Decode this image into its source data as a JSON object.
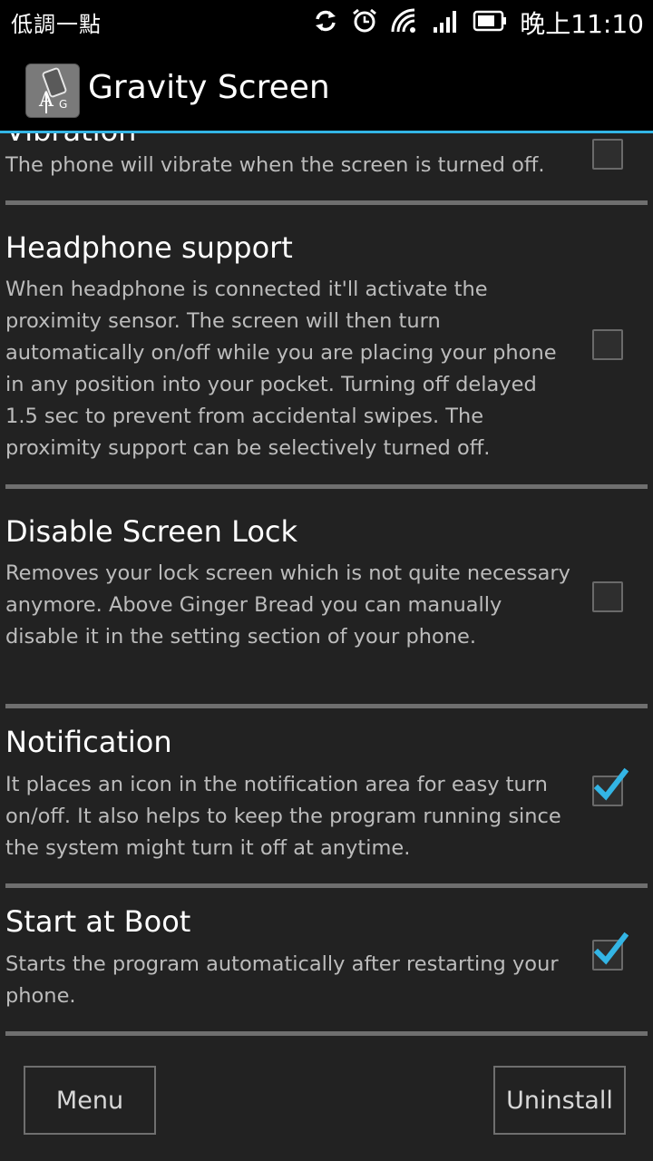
{
  "status_bar": {
    "carrier": "低調一點",
    "time": "晚上11:10",
    "icons": [
      "sync-icon",
      "alarm-icon",
      "wifi-icon",
      "signal-icon",
      "battery-icon"
    ]
  },
  "app": {
    "title": "Gravity Screen",
    "icon_letters": "AG"
  },
  "settings": {
    "vibration": {
      "title": "Vibration",
      "summary": "The phone will vibrate when the screen is turned off.",
      "checked": false
    },
    "headphone": {
      "title": "Headphone support",
      "summary": "When headphone is connected it'll activate the proximity sensor. The screen will then turn automatically on/off while you are placing your phone in any position into your pocket. Turning off delayed 1.5 sec to prevent from accidental swipes. The proximity support can be selectively turned off.",
      "checked": false
    },
    "screen_lock": {
      "title": "Disable Screen Lock",
      "summary": "Removes your lock screen which is not quite necessary anymore. Above Ginger Bread you can manually disable it in the setting section of your phone.",
      "checked": false
    },
    "notification": {
      "title": "Notification",
      "summary": "It places an icon in the notification area for easy turn on/off. It also helps to keep the program running since the system might turn it off at anytime.",
      "checked": true
    },
    "boot": {
      "title": "Start at Boot",
      "summary": "Starts the program automatically after restarting your phone.",
      "checked": true
    }
  },
  "buttons": {
    "menu": "Menu",
    "uninstall": "Uninstall"
  },
  "colors": {
    "accent": "#33b5e5",
    "background": "#222222"
  }
}
